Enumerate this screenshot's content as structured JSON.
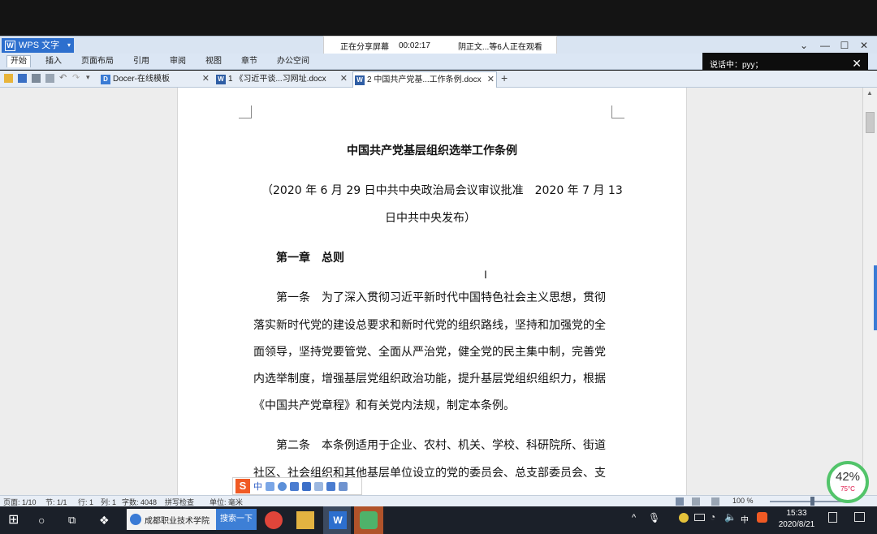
{
  "app": {
    "name": "WPS 文字",
    "window_controls": [
      "⌄",
      "—",
      "☐",
      "✕"
    ]
  },
  "share_bar": {
    "status": "正在分享屏幕",
    "elapsed": "00:02:17",
    "viewers": "阴正文...等6人正在观看"
  },
  "talk_box": {
    "text": "说话中：pyy；"
  },
  "ribbon": {
    "tabs": [
      "开始",
      "插入",
      "页面布局",
      "引用",
      "审阅",
      "视图",
      "章节",
      "办公空间"
    ]
  },
  "doc_tabs": [
    {
      "label": "Docer-在线模板",
      "icon": "D"
    },
    {
      "label": "1  《习近平谈...习网址.docx",
      "icon": "W"
    },
    {
      "label": "2  中国共产党基...工作条例.docx",
      "icon": "W"
    }
  ],
  "document": {
    "title": "中国共产党基层组织选举工作条例",
    "subtitle_line1": "（2020 年 6 月 29 日中共中央政治局会议审议批准　2020 年 7 月 13",
    "subtitle_line2": "日中共中央发布）",
    "chapter": "第一章　总则",
    "p1_l1": "第一条　为了深入贯彻习近平新时代中国特色社会主义思想，贯彻",
    "p1_l2": "落实新时代党的建设总要求和新时代党的组织路线，坚持和加强党的全",
    "p1_l3": "面领导，坚持党要管党、全面从严治党，健全党的民主集中制，完善党",
    "p1_l4": "内选举制度，增强基层党组织政治功能，提升基层党组织组织力，根据",
    "p1_l5": "《中国共产党章程》和有关党内法规，制定本条例。",
    "p2_l1": "第二条　本条例适用于企业、农村、机关、学校、科研院所、街道",
    "p2_l2": "社区、社会组织和其他基层单位设立的党的委员会、总支部委员会、支"
  },
  "ime": {
    "logo": "S",
    "mode": "中"
  },
  "statusbar": {
    "page": "页面: 1/10",
    "section": "节: 1/1",
    "line": "行: 1",
    "col": "列: 1",
    "words": "字数: 4048",
    "spell": "拼写检查",
    "unit": "单位: 毫米",
    "zoom": "100 %"
  },
  "taskbar": {
    "search_text": "成都职业技术学院",
    "search_btn": "搜索一下",
    "ime_indicator": "中",
    "time": "15:33",
    "date": "2020/8/21"
  },
  "gauge": {
    "percent": "42%",
    "temp": "75°C"
  }
}
